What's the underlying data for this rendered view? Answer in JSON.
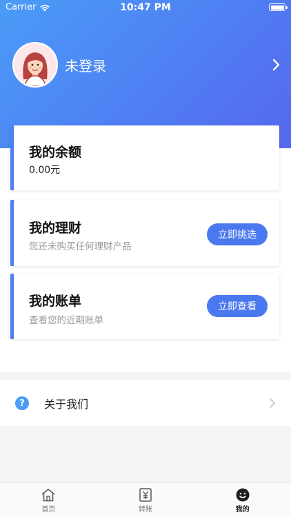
{
  "status_bar": {
    "carrier": "Carrier",
    "time": "10:47 PM"
  },
  "profile": {
    "login_text": "未登录",
    "avatar_icon": "avatar-woman-icon"
  },
  "cards": {
    "balance": {
      "title": "我的余额",
      "value": "0.00元"
    },
    "finance": {
      "title": "我的理财",
      "subtitle": "您还未购买任何理财产品",
      "button": "立即挑选"
    },
    "bill": {
      "title": "我的账单",
      "subtitle": "查看您的近期账单",
      "button": "立即查看"
    }
  },
  "about": {
    "label": "关于我们",
    "icon": "question-icon",
    "icon_text": "?"
  },
  "tabs": [
    {
      "label": "首页",
      "icon": "home-icon"
    },
    {
      "label": "转账",
      "icon": "yen-icon"
    },
    {
      "label": "我的",
      "icon": "smiley-icon"
    }
  ],
  "colors": {
    "accent": "#4a78ef",
    "header_start": "#4a9cf7",
    "header_end": "#5667ee"
  }
}
